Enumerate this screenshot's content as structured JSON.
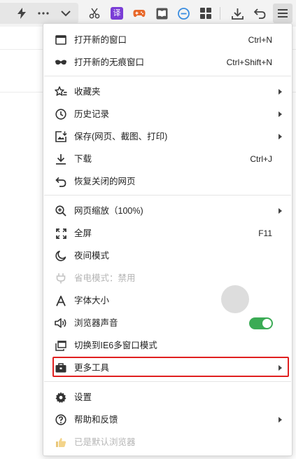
{
  "toolbar": {
    "icons": [
      "lightning-icon",
      "more-dots-icon",
      "chevron-down-icon",
      "scissors-icon",
      "translate-icon",
      "gamepad-icon",
      "reader-icon",
      "minus-circle-icon",
      "apps-grid-icon",
      "download-icon",
      "undo-icon",
      "menu-icon"
    ],
    "translate_badge": "译"
  },
  "menu": {
    "new_window": {
      "label": "打开新的窗口",
      "shortcut": "Ctrl+N"
    },
    "new_incognito": {
      "label": "打开新的无痕窗口",
      "shortcut": "Ctrl+Shift+N"
    },
    "favorites": {
      "label": "收藏夹"
    },
    "history": {
      "label": "历史记录"
    },
    "save": {
      "label": "保存(网页、截图、打印)"
    },
    "download": {
      "label": "下载",
      "shortcut": "Ctrl+J"
    },
    "restore_closed": {
      "label": "恢复关闭的网页"
    },
    "zoom": {
      "label": "网页缩放（100%)"
    },
    "fullscreen": {
      "label": "全屏",
      "shortcut": "F11"
    },
    "night_mode": {
      "label": "夜间模式"
    },
    "power_save": {
      "label": "省电模式：禁用"
    },
    "font_size": {
      "label": "字体大小"
    },
    "browser_sound": {
      "label": "浏览器声音",
      "enabled": true
    },
    "ie6_mode": {
      "label": "切换到IE6多窗口模式"
    },
    "more_tools": {
      "label": "更多工具"
    },
    "settings": {
      "label": "设置"
    },
    "help": {
      "label": "帮助和反馈"
    },
    "default_browser": {
      "label": "已是默认浏览器"
    }
  },
  "colors": {
    "toggle_on": "#3bab55",
    "highlight": "#e02020",
    "translate_badge": "#7a3dd6",
    "gamepad": "#e8682a",
    "minus_circle": "#3a8de0"
  }
}
